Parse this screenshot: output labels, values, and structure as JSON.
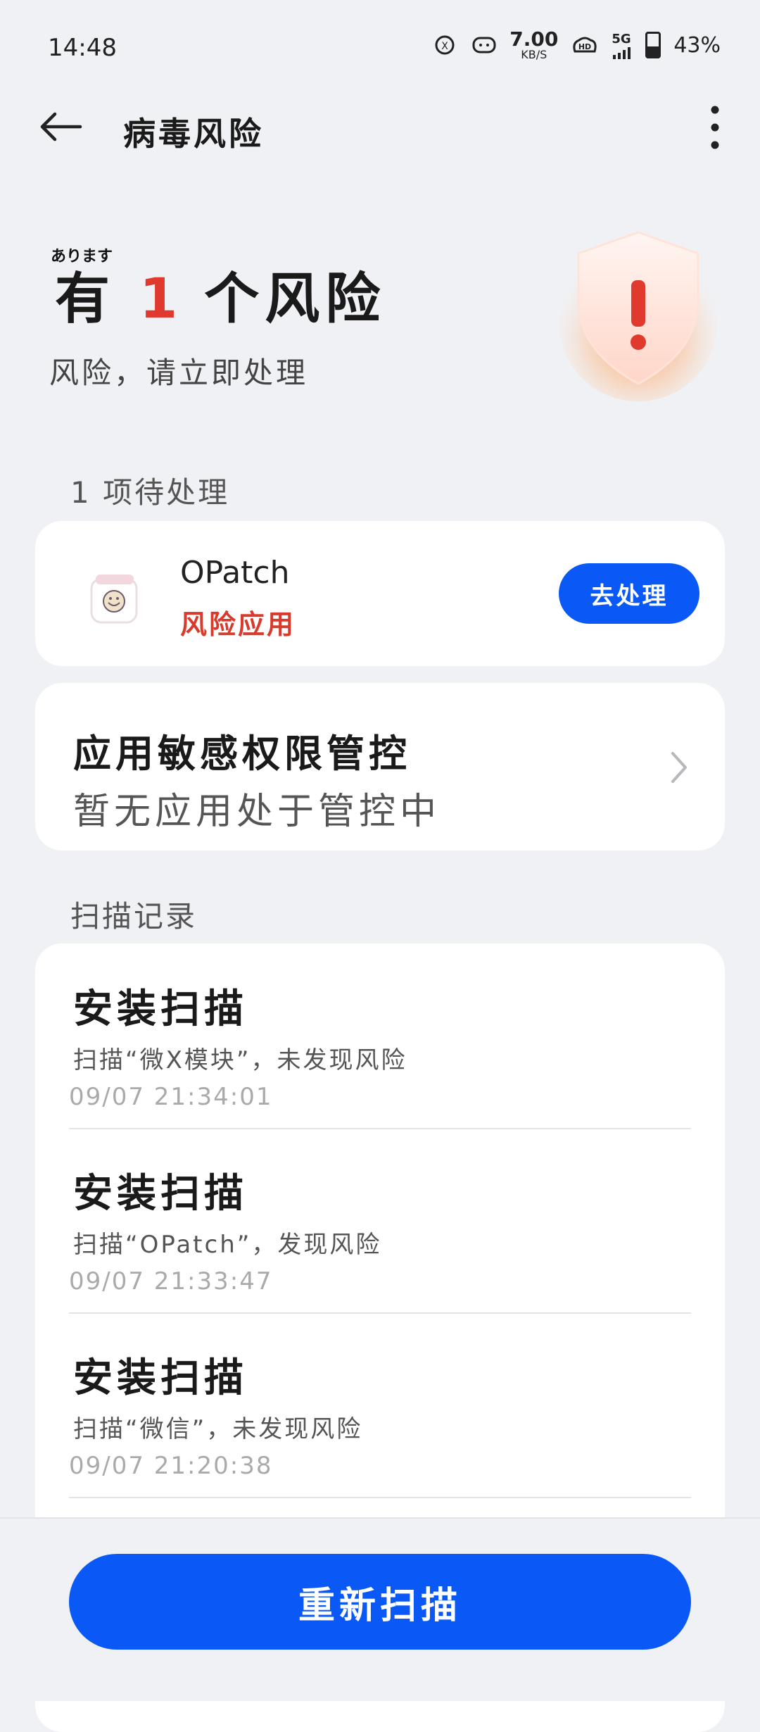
{
  "status_bar": {
    "time": "14:48",
    "net_speed_value": "7.00",
    "net_speed_unit": "KB/S",
    "network_label": "5G",
    "battery_percent": "43%",
    "battery_level": 0.43,
    "icons": [
      "vpn-icon",
      "game-icon",
      "net-speed",
      "hd-icon",
      "5g-signal-icon",
      "battery-icon"
    ]
  },
  "header": {
    "title": "病毒风险",
    "back_icon": "arrow-left-icon",
    "more_icon": "more-vertical-icon"
  },
  "hero": {
    "ruby": "あります",
    "prefix": "有",
    "count": "1",
    "suffix": "个风险",
    "subtitle": "风险，请立即处理",
    "shield_icon": "warning-shield-icon",
    "accent_color": "#e03a2e"
  },
  "pending": {
    "label": "1 项待处理",
    "app_name": "OPatch",
    "app_status": "风险应用",
    "action_label": "去处理"
  },
  "permission": {
    "title": "应用敏感权限管控",
    "subtitle": "暂无应用处于管控中"
  },
  "scan_records": {
    "label": "扫描记录",
    "items": [
      {
        "title": "安装扫描",
        "desc": "扫描“微X模块”，未发现风险",
        "time": "09/07  21:34:01"
      },
      {
        "title": "安装扫描",
        "desc": "扫描“OPatch”，发现风险",
        "time": "09/07  21:33:47"
      },
      {
        "title": "安装扫描",
        "desc": "扫描“微信”，未发现风险",
        "time": "09/07  21:20:38"
      }
    ]
  },
  "bottom": {
    "rescan_label": "重新扫描",
    "primary_color": "#0a59f7"
  }
}
